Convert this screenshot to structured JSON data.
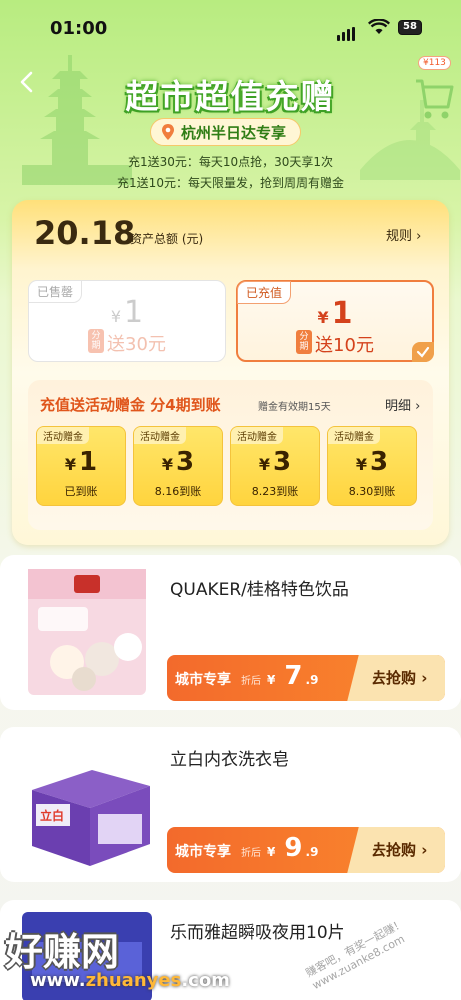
{
  "status": {
    "time": "01:00",
    "battery": "58"
  },
  "header": {
    "title": "超市超值充赠",
    "cart_badge": "¥113",
    "location": "杭州半日达专享",
    "promo_lines": [
      "充1送30元：每天10点抢，30天享1次",
      "充1送10元：每天限量发，抢到周周有赠金"
    ]
  },
  "assets": {
    "amount": "20.18",
    "label": "资产总额 (元)",
    "rules": "规则 ›"
  },
  "options": [
    {
      "tag": "已售罄",
      "currency": "¥",
      "amount": "1",
      "fen": "分期",
      "gift": "送30元",
      "state": "sold-out"
    },
    {
      "tag": "已充值",
      "currency": "¥",
      "amount": "1",
      "fen": "分期",
      "gift": "送10元",
      "state": "selected"
    }
  ],
  "gift_panel": {
    "title": "充值送活动赠金  分4期到账",
    "note": "赠金有效期15天",
    "detail": "明细 ›",
    "cards": [
      {
        "tag": "活动赠金",
        "currency": "¥",
        "amount": "1",
        "when": "已到账"
      },
      {
        "tag": "活动赠金",
        "currency": "¥",
        "amount": "3",
        "when": "8.16到账"
      },
      {
        "tag": "活动赠金",
        "currency": "¥",
        "amount": "3",
        "when": "8.23到账"
      },
      {
        "tag": "活动赠金",
        "currency": "¥",
        "amount": "3",
        "when": "8.30到账"
      }
    ]
  },
  "products": [
    {
      "name": "QUAKER/桂格特色饮品",
      "zone": "城市专享",
      "after": "折后",
      "currency": "¥",
      "price_int": "7",
      "price_dec": ".9",
      "button": "去抢购 ›"
    },
    {
      "name": "立白内衣洗衣皂",
      "zone": "城市专享",
      "after": "折后",
      "currency": "¥",
      "price_int": "9",
      "price_dec": ".9",
      "button": "去抢购 ›"
    },
    {
      "name": "乐而雅超瞬吸夜用10片"
    }
  ],
  "watermark": {
    "main": "好赚网",
    "url_a": "www.",
    "url_b": "zhuanyes",
    "url_c": ".com",
    "note": "赚客吧，有奖一起赚！www.zuanke8.com"
  },
  "colors": {
    "accent": "#f36a2c",
    "brand_green": "#3da025",
    "gold": "#ffd43e"
  }
}
